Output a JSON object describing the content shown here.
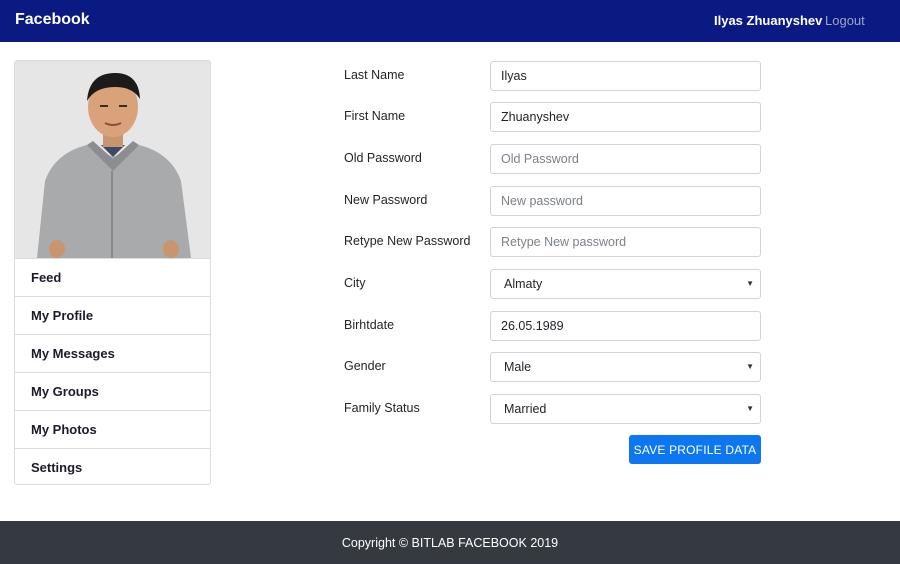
{
  "navbar": {
    "brand": "Facebook",
    "user_name": "Ilyas Zhuanyshev",
    "logout_label": "Logout",
    "bg_color": "#0a1a82"
  },
  "sidebar": {
    "items": [
      {
        "label": "Feed"
      },
      {
        "label": "My Profile"
      },
      {
        "label": "My Messages"
      },
      {
        "label": "My Groups"
      },
      {
        "label": "My Photos"
      },
      {
        "label": "Settings"
      }
    ]
  },
  "form": {
    "last_name": {
      "label": "Last Name",
      "value": "Ilyas"
    },
    "first_name": {
      "label": "First Name",
      "value": "Zhuanyshev"
    },
    "old_password": {
      "label": "Old Password",
      "placeholder": "Old Password"
    },
    "new_password": {
      "label": "New Password",
      "placeholder": "New password"
    },
    "retype_password": {
      "label": "Retype New Password",
      "placeholder": "Retype New password"
    },
    "city": {
      "label": "City",
      "value": "Almaty"
    },
    "birthdate": {
      "label": "Birhtdate",
      "value": "26.05.1989"
    },
    "gender": {
      "label": "Gender",
      "value": "Male"
    },
    "family_status": {
      "label": "Family Status",
      "value": "Married"
    },
    "save_label": "SAVE PROFILE DATA",
    "accent_color": "#0d77f2"
  },
  "footer": {
    "text": "Copyright © BITLAB FACEBOOK 2019"
  },
  "icons": {
    "dropdown": "caret-down-icon"
  }
}
